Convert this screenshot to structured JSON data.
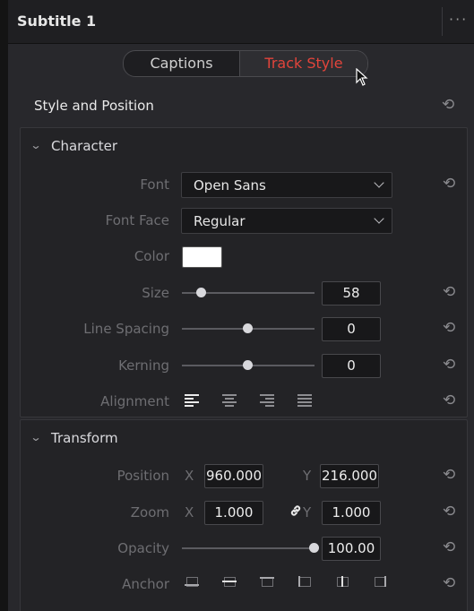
{
  "header": {
    "title": "Subtitle 1",
    "more_icon": "ellipsis-icon"
  },
  "tabs": [
    {
      "label": "Captions",
      "active": false
    },
    {
      "label": "Track Style",
      "active": true
    }
  ],
  "colors": {
    "accent": "#e2443b",
    "panel": "#28282c",
    "text": "#e6e6e6",
    "label": "#6e6e72"
  },
  "section": {
    "title": "Style and Position"
  },
  "character": {
    "title": "Character",
    "font": {
      "label": "Font",
      "value": "Open Sans"
    },
    "font_face": {
      "label": "Font Face",
      "value": "Regular"
    },
    "color": {
      "label": "Color",
      "value": "#ffffff"
    },
    "size": {
      "label": "Size",
      "value": "58",
      "level": 0.15
    },
    "line_spacing": {
      "label": "Line Spacing",
      "value": "0",
      "level": 0.5
    },
    "kerning": {
      "label": "Kerning",
      "value": "0",
      "level": 0.5
    },
    "alignment": {
      "label": "Alignment",
      "options": [
        "left",
        "center",
        "right",
        "justify"
      ],
      "selected": "left"
    }
  },
  "transform": {
    "title": "Transform",
    "position": {
      "label": "Position",
      "x_axis": "X",
      "x": "960.000",
      "y_axis": "Y",
      "y": "216.000"
    },
    "zoom": {
      "label": "Zoom",
      "x_axis": "X",
      "x": "1.000",
      "y_axis": "Y",
      "y": "1.000",
      "link_icon": "link-icon"
    },
    "opacity": {
      "label": "Opacity",
      "value": "100.00",
      "level": 1.0
    },
    "anchor": {
      "label": "Anchor",
      "options": [
        "bottom",
        "middle",
        "top",
        "left",
        "center",
        "right"
      ]
    }
  }
}
